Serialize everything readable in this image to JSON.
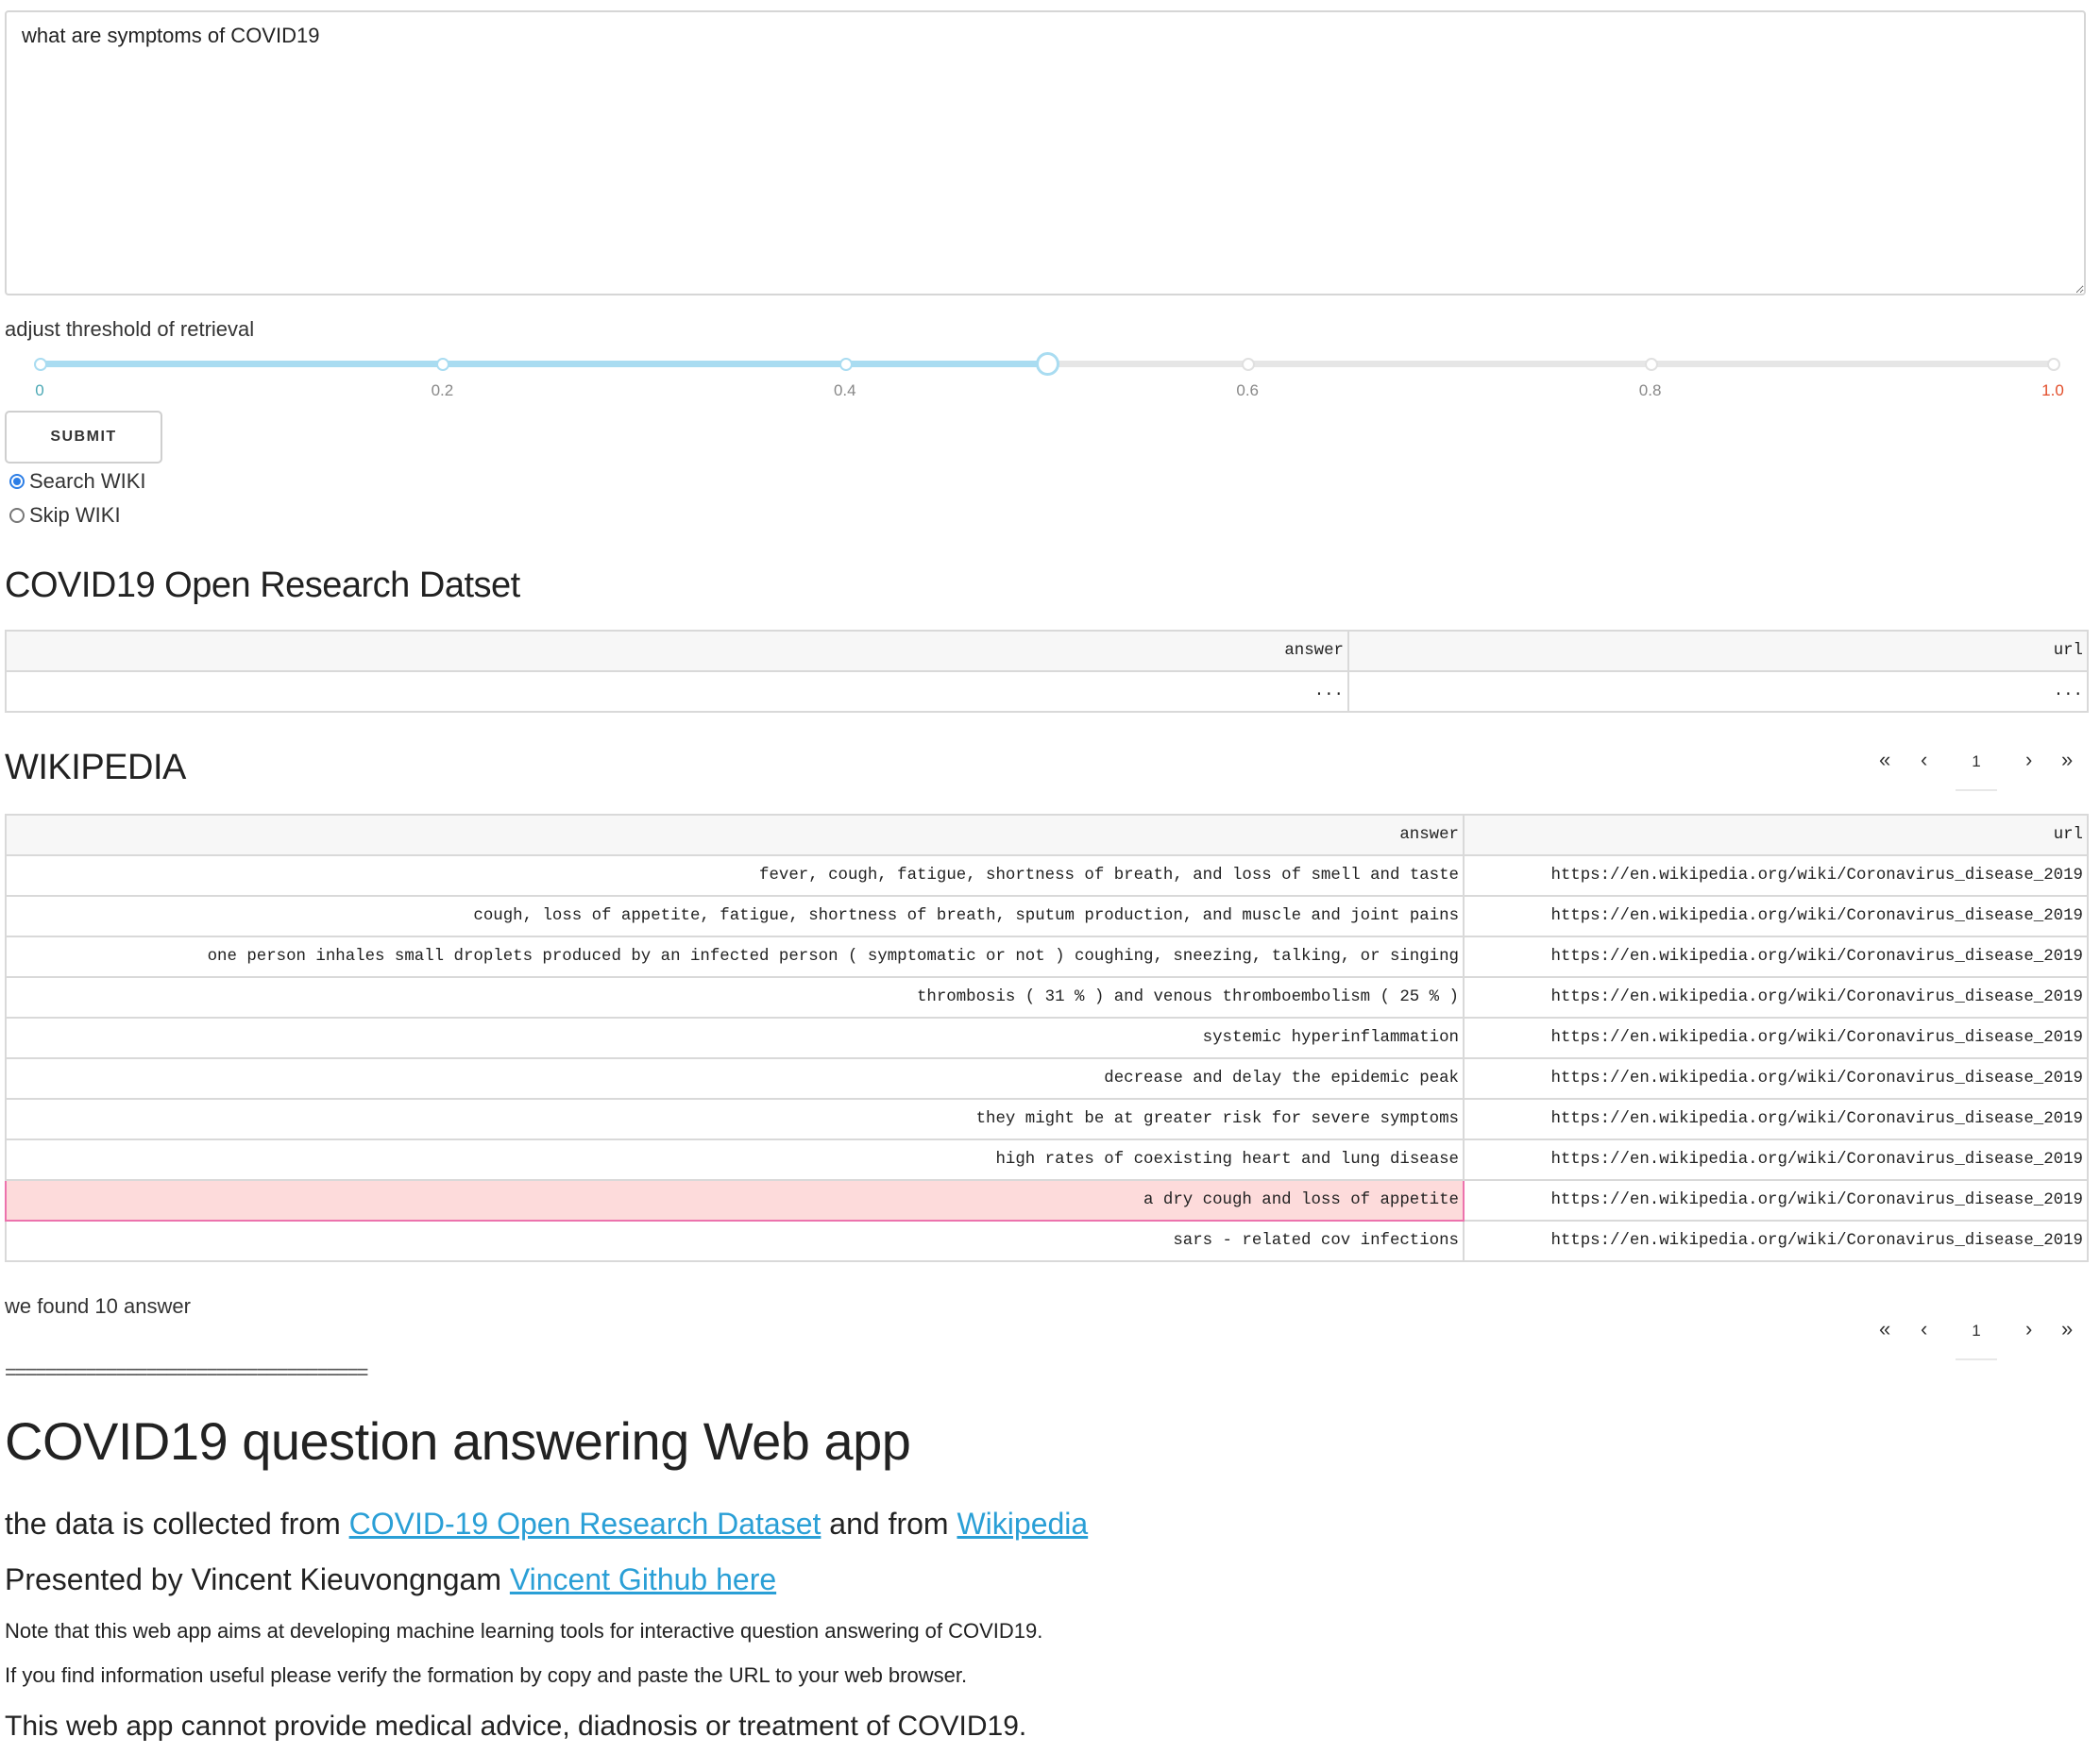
{
  "query": {
    "value": "what are symptoms of COVID19"
  },
  "threshold": {
    "label": "adjust threshold of retrieval",
    "min": 0,
    "max": 1.0,
    "value": 0.5,
    "step": 0.1,
    "marks": [
      "0",
      "0.2",
      "0.4",
      "0.6",
      "0.8",
      "1.0"
    ],
    "track_color": "#e6e6e6",
    "fill_color": "#a9dcf1",
    "first_mark_color": "#4ba8b4",
    "last_mark_color": "#e24e2b"
  },
  "submit": {
    "label": "SUBMIT"
  },
  "wiki_mode": {
    "options": [
      {
        "label": "Search WIKI",
        "checked": true
      },
      {
        "label": "Skip WIKI",
        "checked": false
      }
    ]
  },
  "cord": {
    "title": "COVID19 Open Research Datset",
    "columns": [
      "answer",
      "url"
    ],
    "rows": [
      {
        "answer": "...",
        "url": "..."
      }
    ]
  },
  "wiki": {
    "title": "WIKIPEDIA",
    "columns": [
      "answer",
      "url"
    ],
    "selected_row": 8,
    "selected_color": "#fddbdb",
    "rows": [
      {
        "answer": "fever, cough, fatigue, shortness of breath, and loss of smell and taste",
        "url": "https://en.wikipedia.org/wiki/Coronavirus_disease_2019"
      },
      {
        "answer": "cough, loss of appetite, fatigue, shortness of breath, sputum production, and muscle and joint pains",
        "url": "https://en.wikipedia.org/wiki/Coronavirus_disease_2019"
      },
      {
        "answer": "one person inhales small droplets produced by an infected person ( symptomatic or not ) coughing, sneezing, talking, or singing",
        "url": "https://en.wikipedia.org/wiki/Coronavirus_disease_2019"
      },
      {
        "answer": "thrombosis ( 31 % ) and venous thromboembolism ( 25 % )",
        "url": "https://en.wikipedia.org/wiki/Coronavirus_disease_2019"
      },
      {
        "answer": "systemic hyperinflammation",
        "url": "https://en.wikipedia.org/wiki/Coronavirus_disease_2019"
      },
      {
        "answer": "decrease and delay the epidemic peak",
        "url": "https://en.wikipedia.org/wiki/Coronavirus_disease_2019"
      },
      {
        "answer": "they might be at greater risk for severe symptoms",
        "url": "https://en.wikipedia.org/wiki/Coronavirus_disease_2019"
      },
      {
        "answer": "high rates of coexisting heart and lung disease",
        "url": "https://en.wikipedia.org/wiki/Coronavirus_disease_2019"
      },
      {
        "answer": "a dry cough and loss of appetite",
        "url": "https://en.wikipedia.org/wiki/Coronavirus_disease_2019"
      },
      {
        "answer": "sars - related cov infections",
        "url": "https://en.wikipedia.org/wiki/Coronavirus_disease_2019"
      }
    ]
  },
  "pagination": {
    "first": "«",
    "prev": "‹",
    "page": "1",
    "next": "›",
    "last": "»"
  },
  "found_text": "we found 10 answer",
  "separator": "====================================",
  "footer": {
    "heading": "COVID19 question answering Web app",
    "data_prefix": "the data is collected from",
    "cord_link": "COVID-19 Open Research Dataset",
    "and_from": "and from",
    "wiki_link": "Wikipedia",
    "presented_by": "Presented by Vincent Kieuvongngam",
    "github_link": "Vincent Github here",
    "note1": "Note that this web app aims at developing machine learning tools for interactive question answering of COVID19.",
    "note2": "If you find information useful please verify the formation by copy and paste the URL to your web browser.",
    "disclaimer": "This web app cannot provide medical advice, diadnosis or treatment of COVID19.",
    "link_color": "#2a9fd6"
  }
}
